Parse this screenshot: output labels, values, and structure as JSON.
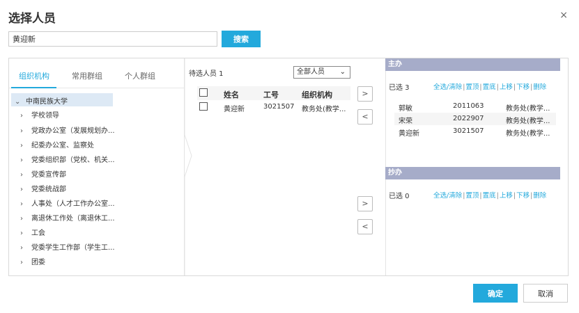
{
  "dialog": {
    "title": "选择人员",
    "close_glyph": "×"
  },
  "search": {
    "value": "黄迎新",
    "button_label": "搜索"
  },
  "tabs": [
    "组织机构",
    "常用群组",
    "个人群组"
  ],
  "tree": {
    "root": "中南民族大学",
    "items": [
      "学校领导",
      "党政办公室（发展规划办...",
      "纪委办公室、监察处",
      "党委组织部（党校、机关...",
      "党委宣传部",
      "党委统战部",
      "人事处（人才工作办公室...",
      "离退休工作处（离退休工...",
      "工会",
      "党委学生工作部（学生工...",
      "团委"
    ]
  },
  "pending": {
    "label": "待选人员 1",
    "filter_value": "全部人员",
    "headers": {
      "name": "姓名",
      "id": "工号",
      "org": "组织机构"
    },
    "rows": [
      {
        "name": "黄迎新",
        "id": "3021507",
        "org": "教务处(教学..."
      }
    ]
  },
  "move_buttons": {
    "add": ">",
    "remove": "<"
  },
  "main": {
    "title": "主办",
    "count": "已选 3",
    "ops": [
      "全选/清除",
      "置顶",
      "置底",
      "上移",
      "下移",
      "删除"
    ],
    "rows": [
      {
        "name": "郭敏",
        "id": "2011063",
        "org": "教务处(教学..."
      },
      {
        "name": "宋荣",
        "id": "2022907",
        "org": "教务处(教学..."
      },
      {
        "name": "黄迎新",
        "id": "3021507",
        "org": "教务处(教学..."
      }
    ]
  },
  "cc": {
    "title": "抄办",
    "count": "已选 0",
    "ops": [
      "全选/清除",
      "置顶",
      "置底",
      "上移",
      "下移",
      "删除"
    ]
  },
  "footer": {
    "ok_label": "确定",
    "cancel_label": "取消"
  },
  "colors": {
    "accent": "#23a9dc",
    "section_header": "#a6acc9",
    "selected_bg": "#dde9f5"
  }
}
